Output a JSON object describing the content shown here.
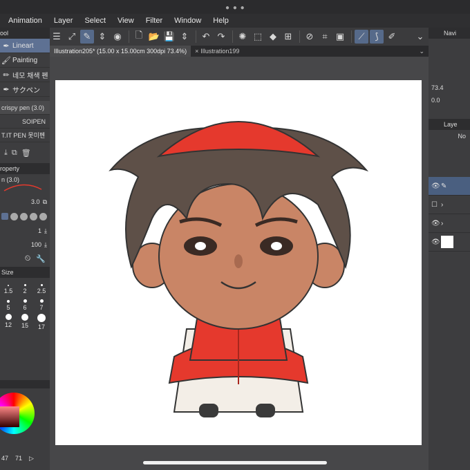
{
  "menu": [
    "Animation",
    "Layer",
    "Select",
    "View",
    "Filter",
    "Window",
    "Help"
  ],
  "tabs": [
    {
      "label": "Illustration205* (15.00 x 15.00cm 300dpi 73.4%)",
      "active": true
    },
    {
      "label": "Illustration199",
      "active": false
    }
  ],
  "left": {
    "tool_head": "ool",
    "subtools": [
      {
        "label": "Lineart",
        "active": true
      },
      {
        "label": "Painting",
        "active": false
      },
      {
        "label": "네모 채색 펜",
        "active": false
      },
      {
        "label": "サクペン",
        "active": false
      }
    ],
    "brushes": [
      "crispy pen (3.0)",
      "SOIPEN",
      "T.IT PEN 못미펜"
    ],
    "property_head": "roperty",
    "property_brush": "n (3.0)",
    "size_value": "3.0",
    "opacity_value": "1",
    "value_100": "100",
    "size_head": "Size",
    "sizes": [
      "1.5",
      "2",
      "2.5",
      "5",
      "6",
      "7",
      "12",
      "15",
      "17"
    ],
    "color_vals": [
      "47",
      "71"
    ]
  },
  "right": {
    "navigator_head": "Navi",
    "zoom_value": "73.4",
    "angle_value": "0.0",
    "layer_head": "Laye",
    "blend_mode": "No"
  },
  "colors": {
    "accent": "#5e7193",
    "canvas_bg": "#474749",
    "cap": "#e5392d",
    "robe": "#e5392d"
  }
}
